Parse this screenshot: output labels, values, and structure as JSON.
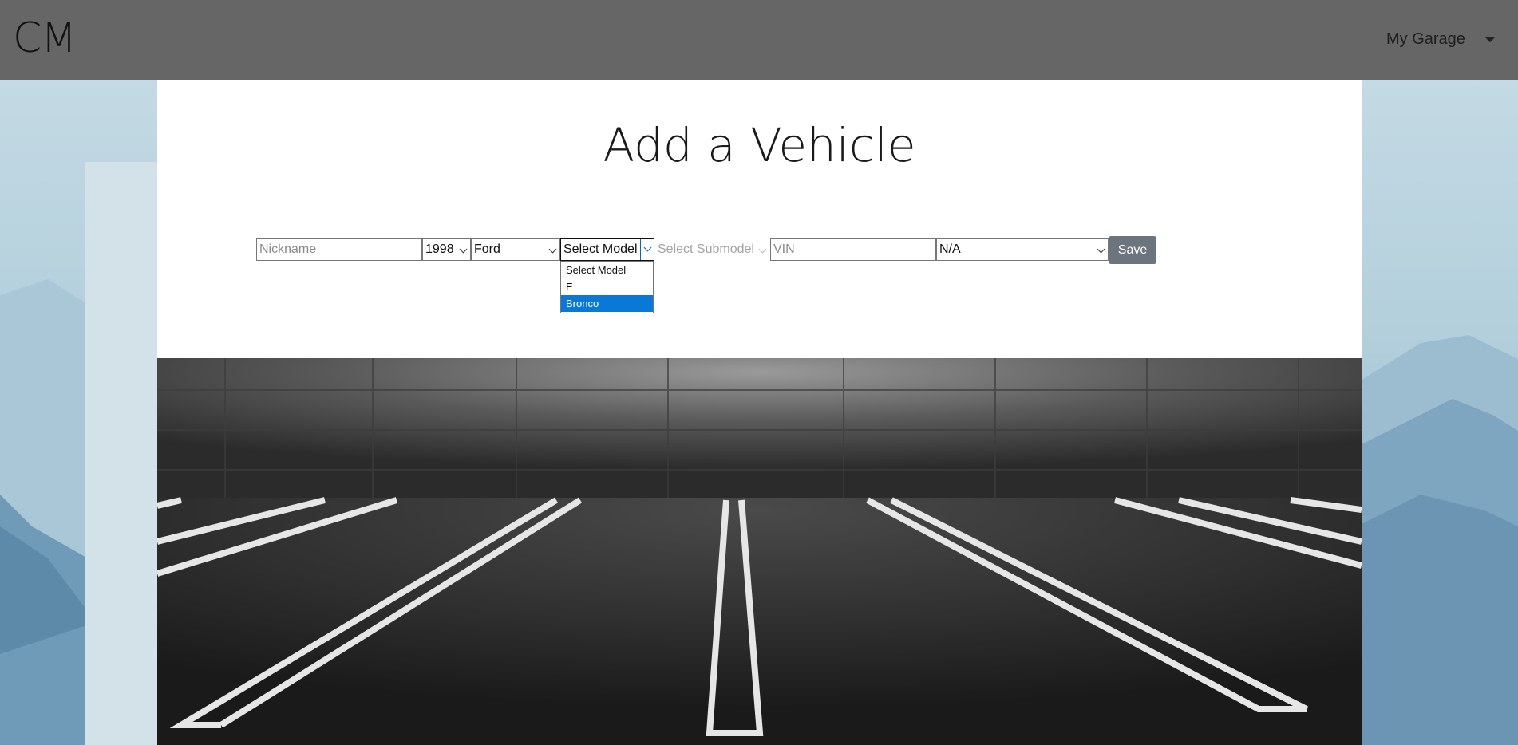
{
  "navbar": {
    "brand": "CM",
    "menu_label": "My Garage"
  },
  "page": {
    "title": "Add a Vehicle"
  },
  "form": {
    "nickname_placeholder": "Nickname",
    "year_value": "1998",
    "make_value": "Ford",
    "model_value": "Select Model",
    "submodel_placeholder": "Select Submodel",
    "vin_placeholder": "VIN",
    "extra_value": "N/A",
    "save_label": "Save"
  },
  "model_dropdown": {
    "options": [
      "Select Model",
      "E",
      "Bronco"
    ],
    "highlighted": "Bronco"
  },
  "colors": {
    "navbar": "#666666",
    "save_button": "#6c757d",
    "highlight": "#0a78d7"
  },
  "icons": [
    "caret-down-icon",
    "chevron-down-icon"
  ]
}
